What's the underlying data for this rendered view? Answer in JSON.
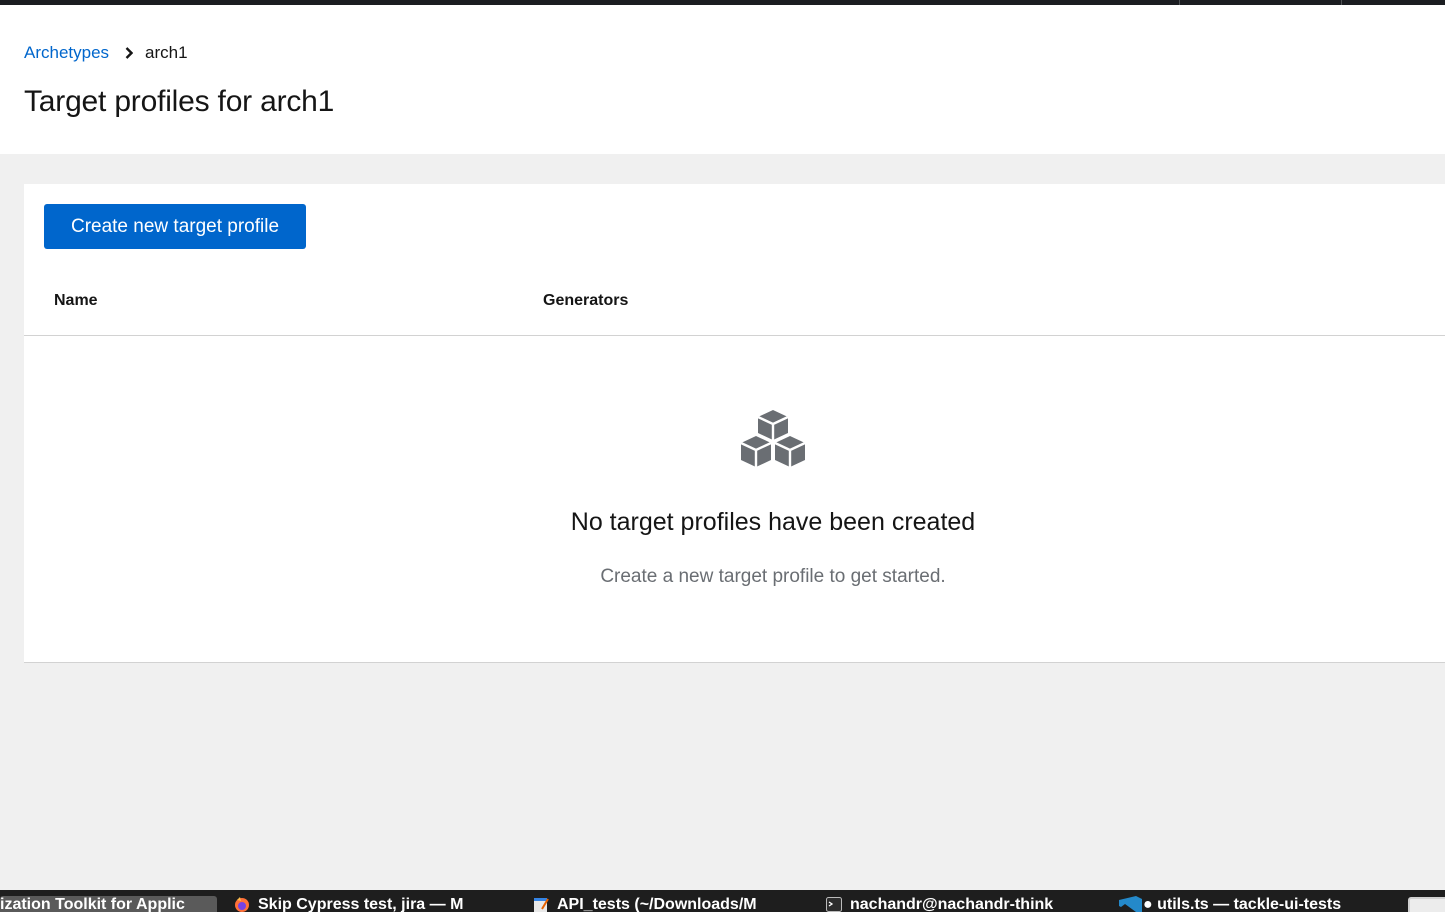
{
  "breadcrumb": {
    "parent": "Archetypes",
    "current": "arch1"
  },
  "page": {
    "title": "Target profiles for arch1"
  },
  "toolbar": {
    "create_label": "Create new target profile"
  },
  "table": {
    "columns": [
      "Name",
      "Generators"
    ]
  },
  "empty_state": {
    "icon": "cubes-icon",
    "title": "No target profiles have been created",
    "body": "Create a new target profile to get started."
  },
  "taskbar": {
    "items": [
      "ization Toolkit for Applic",
      "Skip Cypress test, jira — M",
      "API_tests (~/Downloads/M",
      "nachandr@nachandr-think",
      "● utils.ts — tackle-ui-tests"
    ]
  },
  "colors": {
    "accent": "#0066cc",
    "page_bg": "#f0f0f0",
    "icon_gray": "#6a6e73"
  }
}
